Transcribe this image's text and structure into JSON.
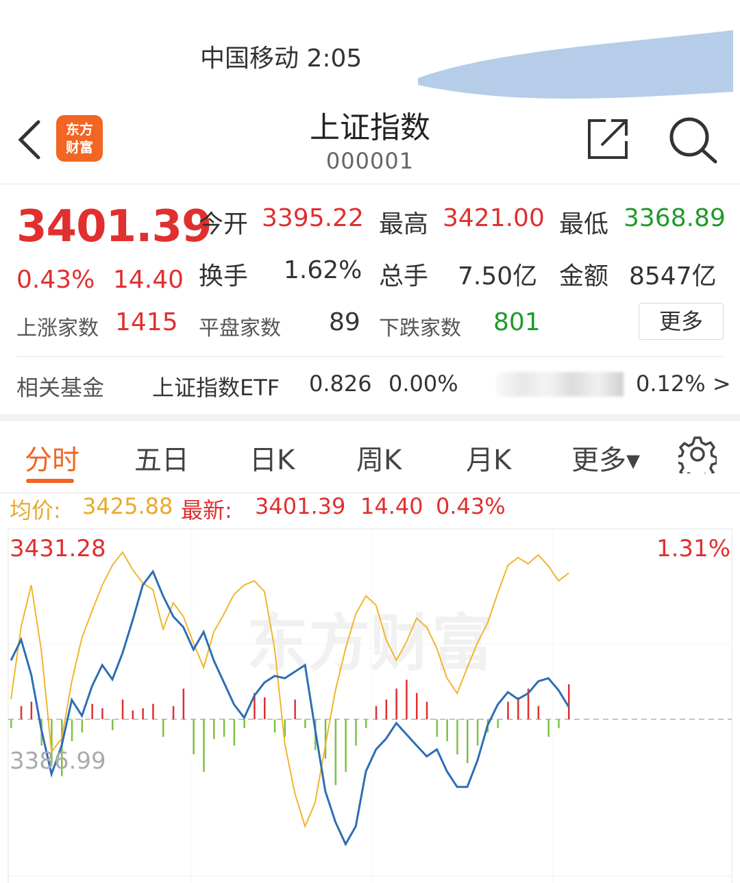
{
  "status_bar": {
    "carrier_time": "中国移动 2:05"
  },
  "header": {
    "title": "上证指数",
    "code": "000001",
    "logo_text_line1": "东方",
    "logo_text_line2": "财富"
  },
  "quote": {
    "last_price": "3401.39",
    "change_pct": "0.43%",
    "change_amt": "14.40",
    "open_label": "今开",
    "open": "3395.22",
    "high_label": "最高",
    "high": "3421.00",
    "low_label": "最低",
    "low": "3368.89",
    "turnover_rate_label": "换手",
    "turnover_rate": "1.62%",
    "volume_label": "总手",
    "volume": "7.50亿",
    "amount_label": "金额",
    "amount": "8547亿",
    "advancers_label": "上涨家数",
    "advancers": "1415",
    "unchanged_label": "平盘家数",
    "unchanged": "89",
    "decliners_label": "下跌家数",
    "decliners": "801",
    "more_button": "更多"
  },
  "related_fund": {
    "label": "相关基金",
    "name": "上证指数ETF",
    "price": "0.826",
    "change": "0.00%",
    "extra_change": "0.12% >"
  },
  "tabs": [
    "分时",
    "五日",
    "日K",
    "周K",
    "月K",
    "更多▾"
  ],
  "active_tab": "分时",
  "legend": {
    "avg_label": "均价:",
    "avg_value": "3425.88",
    "latest_label": "最新:",
    "latest_value": "3401.39",
    "latest_change": "14.40",
    "latest_pct": "0.43%"
  },
  "chart_data": {
    "type": "line",
    "y_top_label": "3431.28",
    "y_prev_close_label": "3386.99",
    "y_right_top_pct": "1.31%",
    "watermark": "东方财富",
    "prev_close": 3386.99,
    "ylim": [
      3342.7,
      3431.28
    ],
    "series": [
      {
        "color": "#2d6db5",
        "values": [
          3402.2,
          3407.6,
          3398.5,
          3384.3,
          3372.8,
          3380.2,
          3392.0,
          3387.9,
          3395.6,
          3401.0,
          3397.3,
          3404.1,
          3412.6,
          3421.7,
          3425.2,
          3418.9,
          3413.6,
          3410.8,
          3405.0,
          3409.6,
          3402.2,
          3396.5,
          3390.8,
          3387.4,
          3393.1,
          3396.5,
          3398.2,
          3397.6,
          3399.3,
          3401.0,
          3384.3,
          3368.4,
          3360.4,
          3354.7,
          3359.3,
          3373.5,
          3379.2,
          3382.0,
          3386.0,
          3383.1,
          3380.2,
          3377.4,
          3379.2,
          3373.5,
          3369.5,
          3369.5,
          3376.3,
          3385.4,
          3390.8,
          3394.0,
          3392.2,
          3393.7,
          3396.8,
          3397.6,
          3394.5,
          3390.2
        ]
      },
      {
        "color": "#f1b52e",
        "values": [
          3392.2,
          3410.9,
          3421.7,
          3404.7,
          3378.6,
          3382.0,
          3396.8,
          3408.1,
          3415.0,
          3421.7,
          3426.8,
          3430.2,
          3425.7,
          3422.2,
          3420.5,
          3410.3,
          3417.1,
          3413.6,
          3406.7,
          3400.4,
          3409.6,
          3414.2,
          3419.3,
          3421.7,
          3422.8,
          3420.0,
          3405.3,
          3380.7,
          3367.8,
          3359.3,
          3365.5,
          3380.2,
          3394.5,
          3405.3,
          3414.2,
          3418.9,
          3416.5,
          3407.6,
          3402.2,
          3407.0,
          3413.1,
          3410.8,
          3405.3,
          3397.6,
          3393.7,
          3400.4,
          3406.7,
          3411.9,
          3419.6,
          3426.8,
          3428.8,
          3427.2,
          3429.5,
          3426.6,
          3422.8,
          3424.8
        ]
      }
    ],
    "volume_bars": [
      -4,
      6,
      8,
      -12,
      -20,
      -26,
      -10,
      -6,
      7,
      5,
      -5,
      9,
      4,
      5,
      7,
      -8,
      6,
      14,
      -16,
      -24,
      -9,
      -8,
      -12,
      -4,
      12,
      10,
      -6,
      -8,
      9,
      -4,
      -14,
      -18,
      -30,
      -24,
      -12,
      -4,
      6,
      9,
      14,
      18,
      12,
      8,
      -8,
      -10,
      -16,
      -20,
      -12,
      -6,
      -4,
      8,
      10,
      14,
      6,
      -8,
      -4,
      16
    ]
  },
  "colors": {
    "accent": "#f26522",
    "up": "#e02f2f",
    "down": "#1f9a2a",
    "avg_line": "#f1b52e",
    "price_line": "#2d6db5"
  },
  "icons": [
    "back-arrow-icon",
    "share-icon",
    "search-icon",
    "gear-icon"
  ]
}
